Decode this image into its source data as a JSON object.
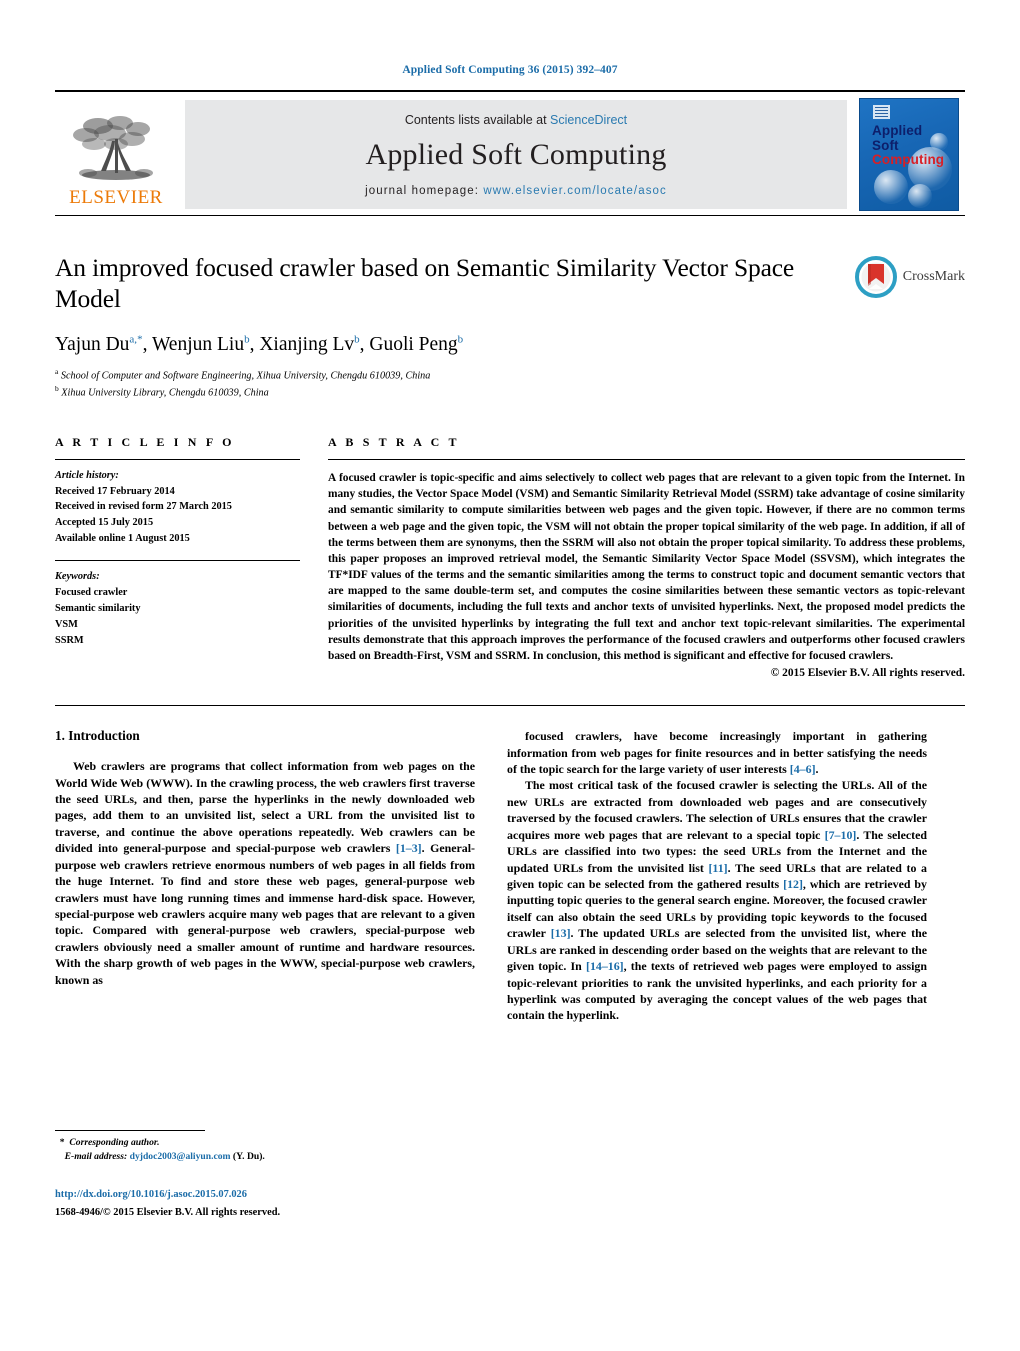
{
  "running_head": "Applied Soft Computing 36 (2015) 392–407",
  "masthead": {
    "publisher_name": "ELSEVIER",
    "contents_prefix": "Contents lists available at ",
    "contents_link": "ScienceDirect",
    "journal_title": "Applied Soft Computing",
    "homepage_prefix": "journal homepage: ",
    "homepage_url": "www.elsevier.com/locate/asoc",
    "cover": {
      "line1": "Applied",
      "line2": "Soft",
      "line3": "Computing"
    }
  },
  "article": {
    "title": "An improved focused crawler based on Semantic Similarity Vector Space Model",
    "authors_html": "Yajun Du<sup class=\"star\">a,</sup><sup class=\"star\">*</sup>, Wenjun Liu<sup>b</sup>, Xianjing Lv<sup>b</sup>, Guoli Peng<sup>b</sup>",
    "affiliation_a": "School of Computer and Software Engineering, Xihua University, Chengdu 610039, China",
    "affiliation_b": "Xihua University Library, Chengdu 610039, China",
    "crossmark_label": "CrossMark"
  },
  "article_info": {
    "heading": "A R T I C L E   I N F O",
    "history_label": "Article history:",
    "history": [
      "Received 17 February 2014",
      "Received in revised form 27 March 2015",
      "Accepted 15 July 2015",
      "Available online 1 August 2015"
    ],
    "keywords_label": "Keywords:",
    "keywords": [
      "Focused crawler",
      "Semantic similarity",
      "VSM",
      "SSRM"
    ]
  },
  "abstract": {
    "heading": "A B S T R A C T",
    "text": "A focused crawler is topic-specific and aims selectively to collect web pages that are relevant to a given topic from the Internet. In many studies, the Vector Space Model (VSM) and Semantic Similarity Retrieval Model (SSRM) take advantage of cosine similarity and semantic similarity to compute similarities between web pages and the given topic. However, if there are no common terms between a web page and the given topic, the VSM will not obtain the proper topical similarity of the web page. In addition, if all of the terms between them are synonyms, then the SSRM will also not obtain the proper topical similarity. To address these problems, this paper proposes an improved retrieval model, the Semantic Similarity Vector Space Model (SSVSM), which integrates the TF*IDF values of the terms and the semantic similarities among the terms to construct topic and document semantic vectors that are mapped to the same double-term set, and computes the cosine similarities between these semantic vectors as topic-relevant similarities of documents, including the full texts and anchor texts of unvisited hyperlinks. Next, the proposed model predicts the priorities of the unvisited hyperlinks by integrating the full text and anchor text topic-relevant similarities. The experimental results demonstrate that this approach improves the performance of the focused crawlers and outperforms other focused crawlers based on Breadth-First, VSM and SSRM. In conclusion, this method is significant and effective for focused crawlers.",
    "copyright": "© 2015 Elsevier B.V. All rights reserved."
  },
  "introduction": {
    "heading": "1.  Introduction",
    "left_paragraph_html": "Web crawlers are programs that collect information from web pages on the World Wide Web (WWW). In the crawling process, the web crawlers first traverse the seed URLs, and then, parse the hyperlinks in the newly downloaded web pages, add them to an unvisited list, select a URL from the unvisited list to traverse, and continue the above operations repeatedly. Web crawlers can be divided into general-purpose and special-purpose web crawlers <span class=\"ref\">[1–3]</span>. General-purpose web crawlers retrieve enormous numbers of web pages in all fields from the huge Internet. To find and store these web pages, general-purpose web crawlers must have long running times and immense hard-disk space. However, special-purpose web crawlers acquire many web pages that are relevant to a given topic. Compared with general-purpose web crawlers, special-purpose web crawlers obviously need a smaller amount of runtime and hardware resources. With the sharp growth of web pages in the WWW, special-purpose web crawlers, known as",
    "right_paragraph_1_html": "focused crawlers, have become increasingly important in gathering information from web pages for finite resources and in better satisfying the needs of the topic search for the large variety of user interests <span class=\"ref\">[4–6]</span>.",
    "right_paragraph_2_html": "The most critical task of the focused crawler is selecting the URLs. All of the new URLs are extracted from downloaded web pages and are consecutively traversed by the focused crawlers. The selection of URLs ensures that the crawler acquires more web pages that are relevant to a special topic <span class=\"ref\">[7–10]</span>. The selected URLs are classified into two types: the seed URLs from the Internet and the updated URLs from the unvisited list <span class=\"ref\">[11]</span>. The seed URLs that are related to a given topic can be selected from the gathered results <span class=\"ref\">[12]</span>, which are retrieved by inputting topic queries to the general search engine. Moreover, the focused crawler itself can also obtain the seed URLs by providing topic keywords to the focused crawler <span class=\"ref\">[13]</span>. The updated URLs are selected from the unvisited list, where the URLs are ranked in descending order based on the weights that are relevant to the given topic. In <span class=\"ref\">[14–16]</span>, the texts of retrieved web pages were employed to assign topic-relevant priorities to rank the unvisited hyperlinks, and each priority for a hyperlink was computed by averaging the concept values of the web pages that contain the hyperlink."
  },
  "footnote": {
    "corresponding_author": "Corresponding author.",
    "email_label": "E-mail address:",
    "email": "dyjdoc2003@aliyun.com",
    "email_suffix": "(Y. Du).",
    "doi_url": "http://dx.doi.org/10.1016/j.asoc.2015.07.026",
    "issn_line": "1568-4946/© 2015 Elsevier B.V. All rights reserved."
  },
  "colors": {
    "link_blue": "#1b6ca8",
    "elsevier_orange": "#ec7a08",
    "band_gray": "#e6e7e8",
    "cover_blue": "#1766b4",
    "cover_red": "#d81f26"
  }
}
